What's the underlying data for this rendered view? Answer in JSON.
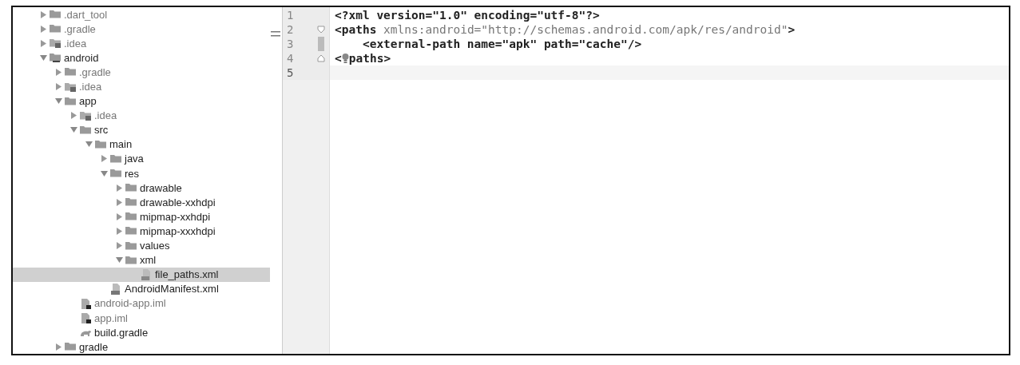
{
  "project_tree": [
    {
      "label": ".dart_tool",
      "kind": "folder",
      "dimmed": true,
      "expanded": false
    },
    {
      "label": ".gradle",
      "kind": "folder",
      "dimmed": true,
      "expanded": false
    },
    {
      "label": ".idea",
      "kind": "idea-folder",
      "dimmed": true,
      "expanded": false
    },
    {
      "label": "android",
      "kind": "module-folder",
      "dimmed": false,
      "expanded": true,
      "children": [
        {
          "label": ".gradle",
          "kind": "folder",
          "dimmed": true,
          "expanded": false
        },
        {
          "label": ".idea",
          "kind": "idea-folder",
          "dimmed": true,
          "expanded": false
        },
        {
          "label": "app",
          "kind": "folder",
          "dimmed": false,
          "expanded": true,
          "children": [
            {
              "label": ".idea",
              "kind": "idea-folder",
              "dimmed": true,
              "expanded": false
            },
            {
              "label": "src",
              "kind": "folder",
              "dimmed": false,
              "expanded": true,
              "children": [
                {
                  "label": "main",
                  "kind": "folder",
                  "dimmed": false,
                  "expanded": true,
                  "children": [
                    {
                      "label": "java",
                      "kind": "folder",
                      "dimmed": false,
                      "expanded": false
                    },
                    {
                      "label": "res",
                      "kind": "folder",
                      "dimmed": false,
                      "expanded": true,
                      "children": [
                        {
                          "label": "drawable",
                          "kind": "folder",
                          "dimmed": false,
                          "expanded": false
                        },
                        {
                          "label": "drawable-xxhdpi",
                          "kind": "folder",
                          "dimmed": false,
                          "expanded": false
                        },
                        {
                          "label": "mipmap-xxhdpi",
                          "kind": "folder",
                          "dimmed": false,
                          "expanded": false
                        },
                        {
                          "label": "mipmap-xxxhdpi",
                          "kind": "folder",
                          "dimmed": false,
                          "expanded": false
                        },
                        {
                          "label": "values",
                          "kind": "folder",
                          "dimmed": false,
                          "expanded": false
                        },
                        {
                          "label": "xml",
                          "kind": "folder",
                          "dimmed": false,
                          "expanded": true,
                          "children": [
                            {
                              "label": "file_paths.xml",
                              "kind": "xml-file",
                              "dimmed": false,
                              "selected": true
                            }
                          ]
                        }
                      ]
                    },
                    {
                      "label": "AndroidManifest.xml",
                      "kind": "manifest-file",
                      "dimmed": false,
                      "selected": false
                    }
                  ]
                }
              ]
            },
            {
              "label": "android-app.iml",
              "kind": "iml-file",
              "dimmed": true,
              "selected": false
            },
            {
              "label": "app.iml",
              "kind": "iml-file",
              "dimmed": true,
              "selected": false
            },
            {
              "label": "build.gradle",
              "kind": "gradle-file",
              "dimmed": false,
              "selected": false
            }
          ]
        },
        {
          "label": "gradle",
          "kind": "folder",
          "dimmed": false,
          "expanded": false
        }
      ]
    }
  ],
  "editor": {
    "lines": [
      {
        "number": "1",
        "current": false,
        "fold_start": false,
        "fold_end": false,
        "bookmark": false,
        "segments": [
          {
            "text": "<?xml version=\"1.0\" encoding=\"utf-8\"?>",
            "kind": "tag"
          }
        ]
      },
      {
        "number": "2",
        "current": false,
        "fold_start": true,
        "fold_end": false,
        "bookmark": false,
        "segments": [
          {
            "text": "<paths",
            "kind": "tag"
          },
          {
            "text": " xmlns:android=\"http://schemas.android.com/apk/res/android\"",
            "kind": "attr"
          },
          {
            "text": ">",
            "kind": "tag"
          }
        ]
      },
      {
        "number": "3",
        "current": false,
        "fold_start": false,
        "fold_end": false,
        "bookmark": true,
        "segments": [
          {
            "text": "    <external-path name=\"apk\" path=\"cache\"/>",
            "kind": "tag"
          }
        ]
      },
      {
        "number": "4",
        "current": false,
        "fold_start": false,
        "fold_end": true,
        "bookmark": false,
        "segments": [
          {
            "text": "<",
            "kind": "tag"
          },
          {
            "kind": "bulb"
          },
          {
            "text": "paths>",
            "kind": "tag"
          }
        ]
      },
      {
        "number": "5",
        "current": true,
        "fold_start": false,
        "fold_end": false,
        "bookmark": false
      }
    ]
  }
}
